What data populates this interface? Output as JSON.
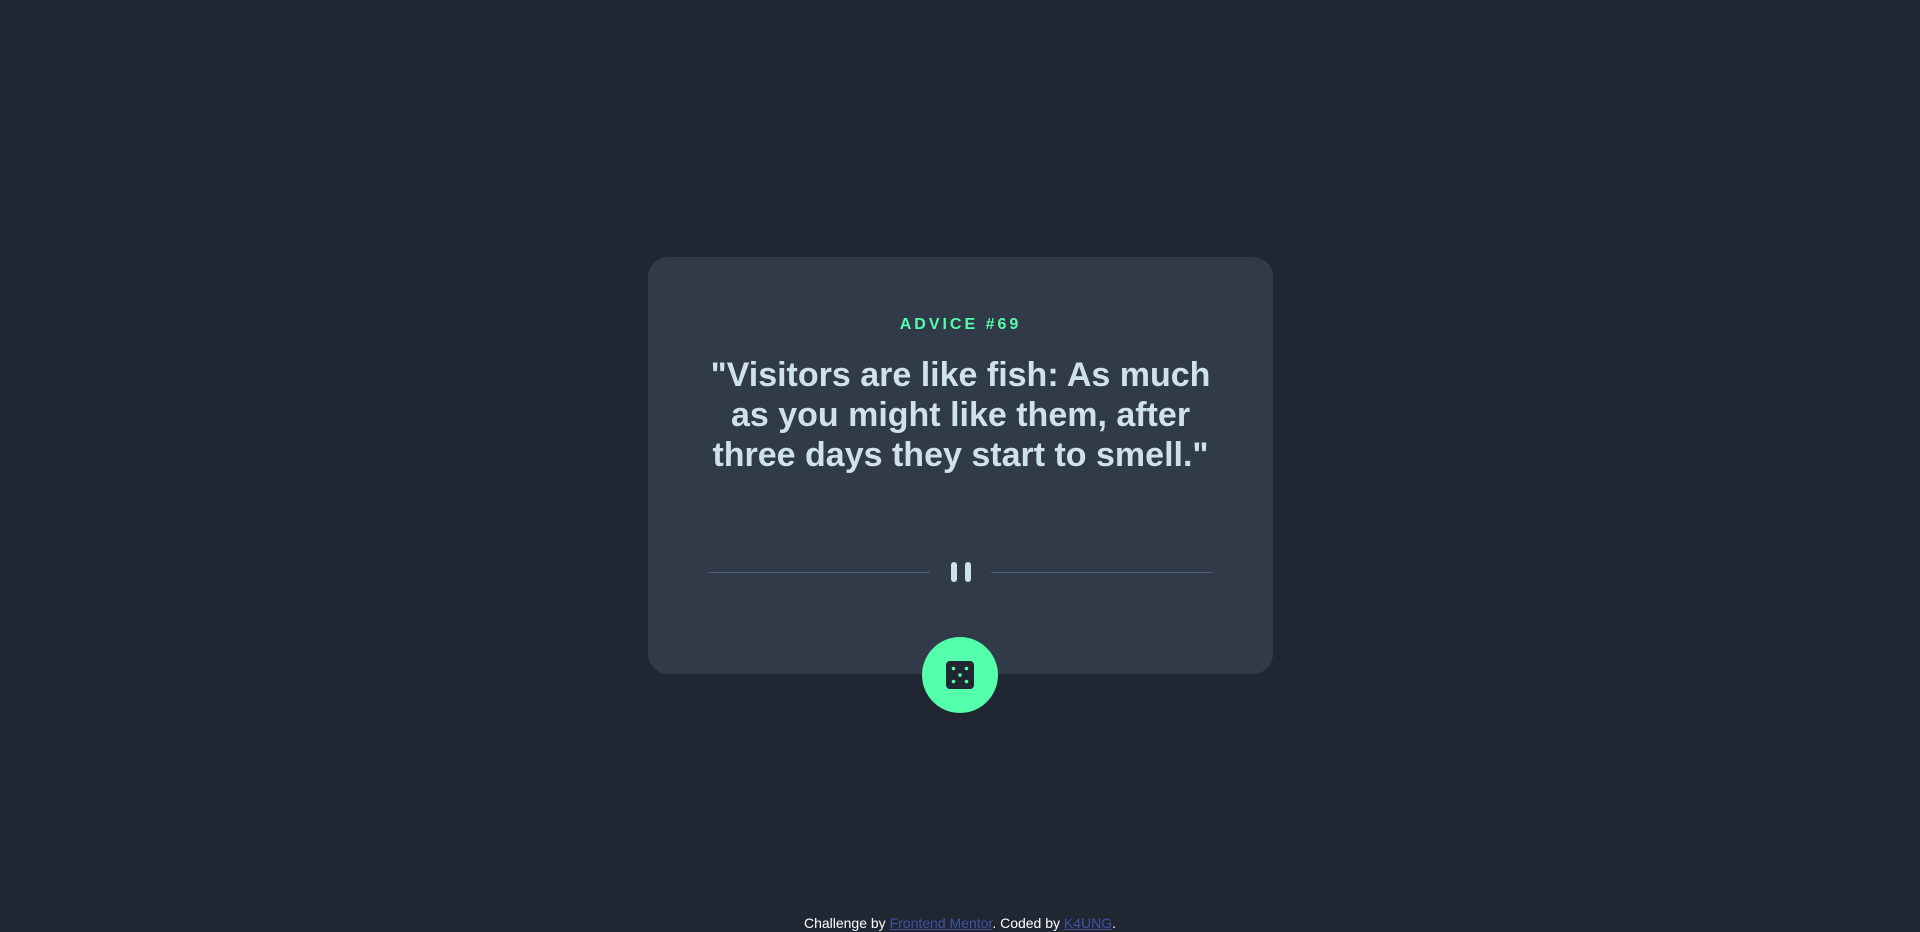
{
  "card": {
    "advice_label": "ADVICE #69",
    "advice_text": "\"Visitors are like fish: As much as you might like them, after three days they start to smell.\""
  },
  "icons": {
    "divider": "pause-icon",
    "button": "dice-icon"
  },
  "footer": {
    "prefix": "Challenge by ",
    "challenge_link": "Frontend Mentor",
    "middle": ". Coded by ",
    "author_link": "K4UNG",
    "suffix": "."
  },
  "colors": {
    "background": "#202733",
    "card": "#313a48",
    "accent": "#53ffaa",
    "text": "#cee3e9",
    "link": "#3e52a3"
  }
}
